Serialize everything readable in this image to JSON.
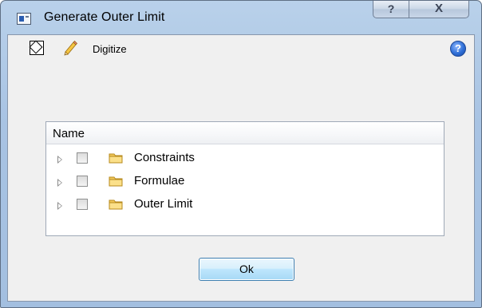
{
  "window": {
    "title": "Generate Outer Limit",
    "help_label": "?",
    "close_label": "X"
  },
  "toolbar": {
    "digitize_label": "Digitize",
    "help_icon_glyph": "?"
  },
  "tree": {
    "header": "Name",
    "items": [
      {
        "label": "Constraints",
        "checked": false,
        "expanded": false
      },
      {
        "label": "Formulae",
        "checked": false,
        "expanded": false
      },
      {
        "label": "Outer Limit",
        "checked": false,
        "expanded": false
      }
    ]
  },
  "buttons": {
    "ok_label": "Ok"
  },
  "colors": {
    "title_bar": "#a8c3e3",
    "client_bg": "#f0f0f0",
    "ok_button": "#bee6fd",
    "folder": "#f2c85a"
  }
}
